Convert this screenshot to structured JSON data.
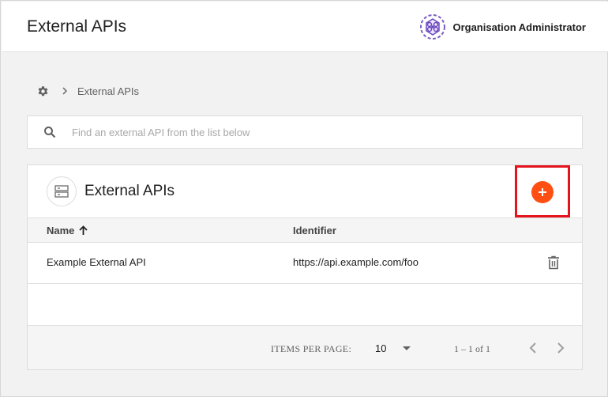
{
  "header": {
    "title": "External APIs",
    "user_name": "Organisation Administrator"
  },
  "breadcrumb": {
    "home_icon": "gear-icon",
    "separator_icon": "chevron-right-icon",
    "current": "External APIs"
  },
  "search": {
    "placeholder": "Find an external API from the list below",
    "value": ""
  },
  "card": {
    "title": "External APIs",
    "icon": "server-icon",
    "add_icon": "plus-icon",
    "accent_color": "#ff4f12",
    "highlight_color": "#e5131d"
  },
  "table": {
    "columns": {
      "name": "Name",
      "identifier": "Identifier"
    },
    "sort": "ascending",
    "rows": [
      {
        "name": "Example External API",
        "identifier": "https://api.example.com/foo"
      }
    ]
  },
  "pagination": {
    "items_per_page_label": "ITEMS PER PAGE:",
    "items_per_page": "10",
    "range": "1 – 1 of 1"
  }
}
